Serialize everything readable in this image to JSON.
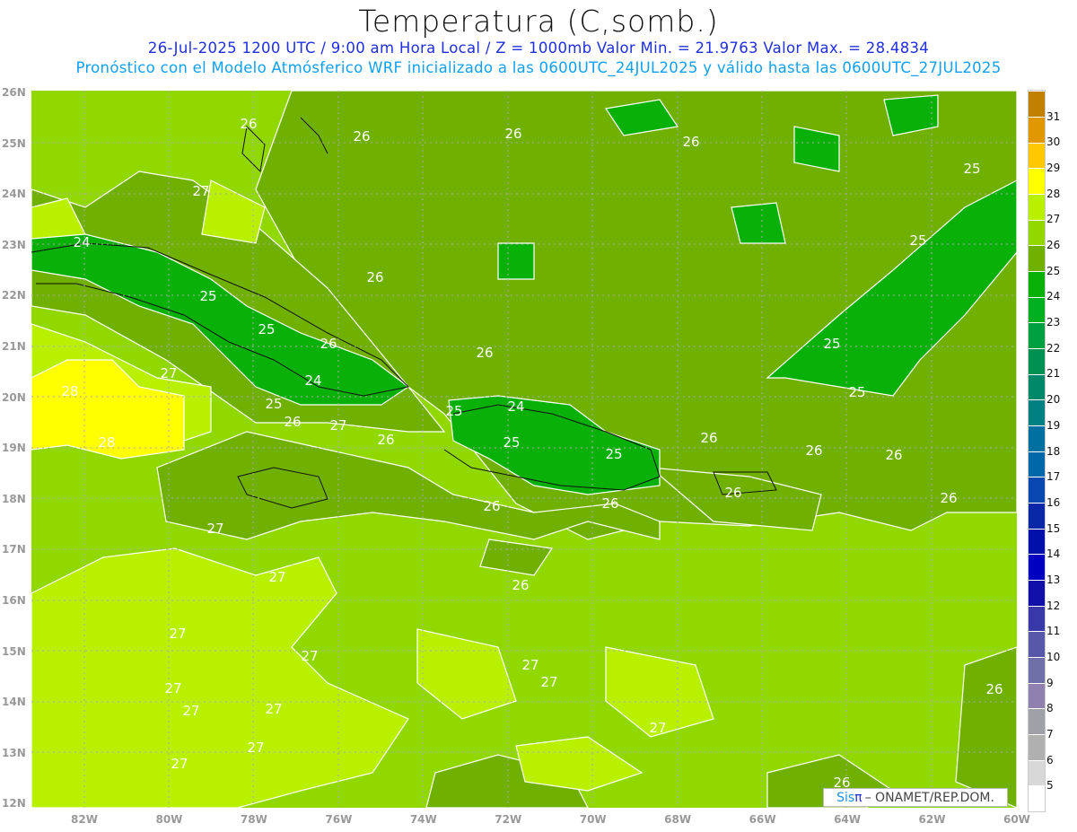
{
  "header": {
    "title": "Temperatura (C,somb.)",
    "line1": "26-Jul-2025  1200 UTC / 9:00 am Hora Local / Z = 1000mb   Valor Min. = 21.9763  Valor Max. = 28.4834",
    "line2": "Pronóstico con el Modelo Atmósferico WRF inicializado a las 0600UTC_24JUL2025 y válido hasta las  0600UTC_27JUL2025"
  },
  "axes": {
    "lat": [
      "26N",
      "25N",
      "24N",
      "23N",
      "22N",
      "21N",
      "20N",
      "19N",
      "18N",
      "17N",
      "16N",
      "15N",
      "14N",
      "13N",
      "12N"
    ],
    "lon": [
      "82W",
      "80W",
      "78W",
      "76W",
      "74W",
      "72W",
      "70W",
      "68W",
      "66W",
      "64W",
      "62W",
      "60W"
    ]
  },
  "colorbar": {
    "labels": [
      "5",
      "6",
      "7",
      "8",
      "9",
      "10",
      "11",
      "12",
      "13",
      "14",
      "15",
      "16",
      "17",
      "18",
      "19",
      "20",
      "21",
      "22",
      "23",
      "24",
      "25",
      "26",
      "27",
      "28",
      "29",
      "30",
      "31"
    ],
    "colors": [
      "#ffffff",
      "#d8d8d8",
      "#b0b0b0",
      "#a0a0a8",
      "#9080b0",
      "#7070a8",
      "#5858a8",
      "#3838a8",
      "#1010a8",
      "#0000c0",
      "#0010a8",
      "#0828a8",
      "#0848b0",
      "#0068a8",
      "#0070a0",
      "#008080",
      "#008868",
      "#009050",
      "#00a040",
      "#00b020",
      "#08b008",
      "#70b000",
      "#90d800",
      "#b8f000",
      "#ffff00",
      "#ffc800",
      "#e09800",
      "#c08000"
    ]
  },
  "contour_labels": [
    "26",
    "26",
    "26",
    "26",
    "25",
    "27",
    "24",
    "26",
    "25",
    "25",
    "25",
    "26",
    "26",
    "25",
    "27",
    "24",
    "28",
    "25",
    "25",
    "24",
    "25",
    "26",
    "27",
    "26",
    "28",
    "25",
    "25",
    "26",
    "26",
    "26",
    "26",
    "26",
    "26",
    "26",
    "27",
    "27",
    "26",
    "27",
    "27",
    "27",
    "27",
    "27",
    "27",
    "27",
    "26",
    "27",
    "27",
    "27",
    "26"
  ],
  "credit": {
    "brand": "Sis",
    "pi": "π",
    "text": "– ONAMET/REP.DOM."
  }
}
